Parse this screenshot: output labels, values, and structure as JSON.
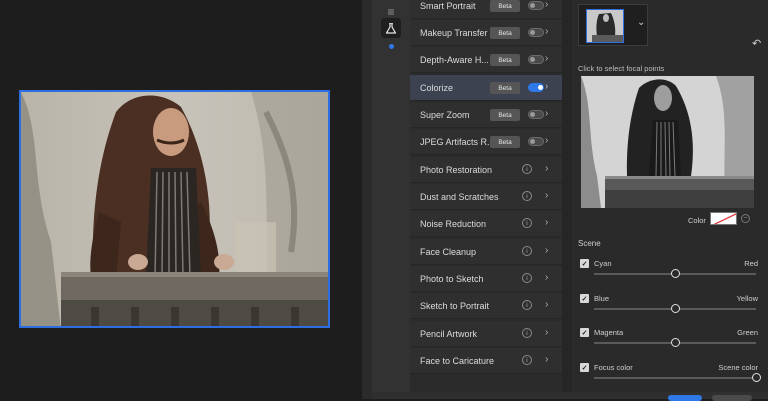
{
  "filters": [
    {
      "label": "Smart Portrait",
      "beta": "Beta",
      "control": "toggle",
      "on": false
    },
    {
      "label": "Makeup Transfer",
      "beta": "Beta",
      "control": "toggle",
      "on": false
    },
    {
      "label": "Depth-Aware H...",
      "beta": "Beta",
      "control": "toggle",
      "on": false
    },
    {
      "label": "Colorize",
      "beta": "Beta",
      "control": "toggle",
      "on": true,
      "selected": true
    },
    {
      "label": "Super Zoom",
      "beta": "Beta",
      "control": "toggle",
      "on": false
    },
    {
      "label": "JPEG Artifacts R...",
      "beta": "Beta",
      "control": "toggle",
      "on": false
    },
    {
      "label": "Photo Restoration",
      "control": "info"
    },
    {
      "label": "Dust and Scratches",
      "control": "info"
    },
    {
      "label": "Noise Reduction",
      "control": "info"
    },
    {
      "label": "Face Cleanup",
      "control": "info"
    },
    {
      "label": "Photo to Sketch",
      "control": "info"
    },
    {
      "label": "Sketch to Portrait",
      "control": "info"
    },
    {
      "label": "Pencil Artwork",
      "control": "info"
    },
    {
      "label": "Face to Caricature",
      "control": "info"
    }
  ],
  "props": {
    "focal_caption": "Click to select focal points",
    "color_label": "Color",
    "scene_label": "Scene",
    "sliders": [
      {
        "left": "Cyan",
        "right": "Red",
        "value": 0.5,
        "checked": true
      },
      {
        "left": "Blue",
        "right": "Yellow",
        "value": 0.5,
        "checked": true
      },
      {
        "left": "Magenta",
        "right": "Green",
        "value": 0.5,
        "checked": true
      },
      {
        "left": "Focus color",
        "right": "Scene color",
        "value": 1.0,
        "checked": true
      }
    ]
  },
  "icons": {
    "info": "i",
    "chevron": "›",
    "chevron_down": "⌄",
    "reset": "↶",
    "check": "✓",
    "minus": "−"
  },
  "colors": {
    "accent": "#2e78e8",
    "selected_row": "#3d4250"
  }
}
